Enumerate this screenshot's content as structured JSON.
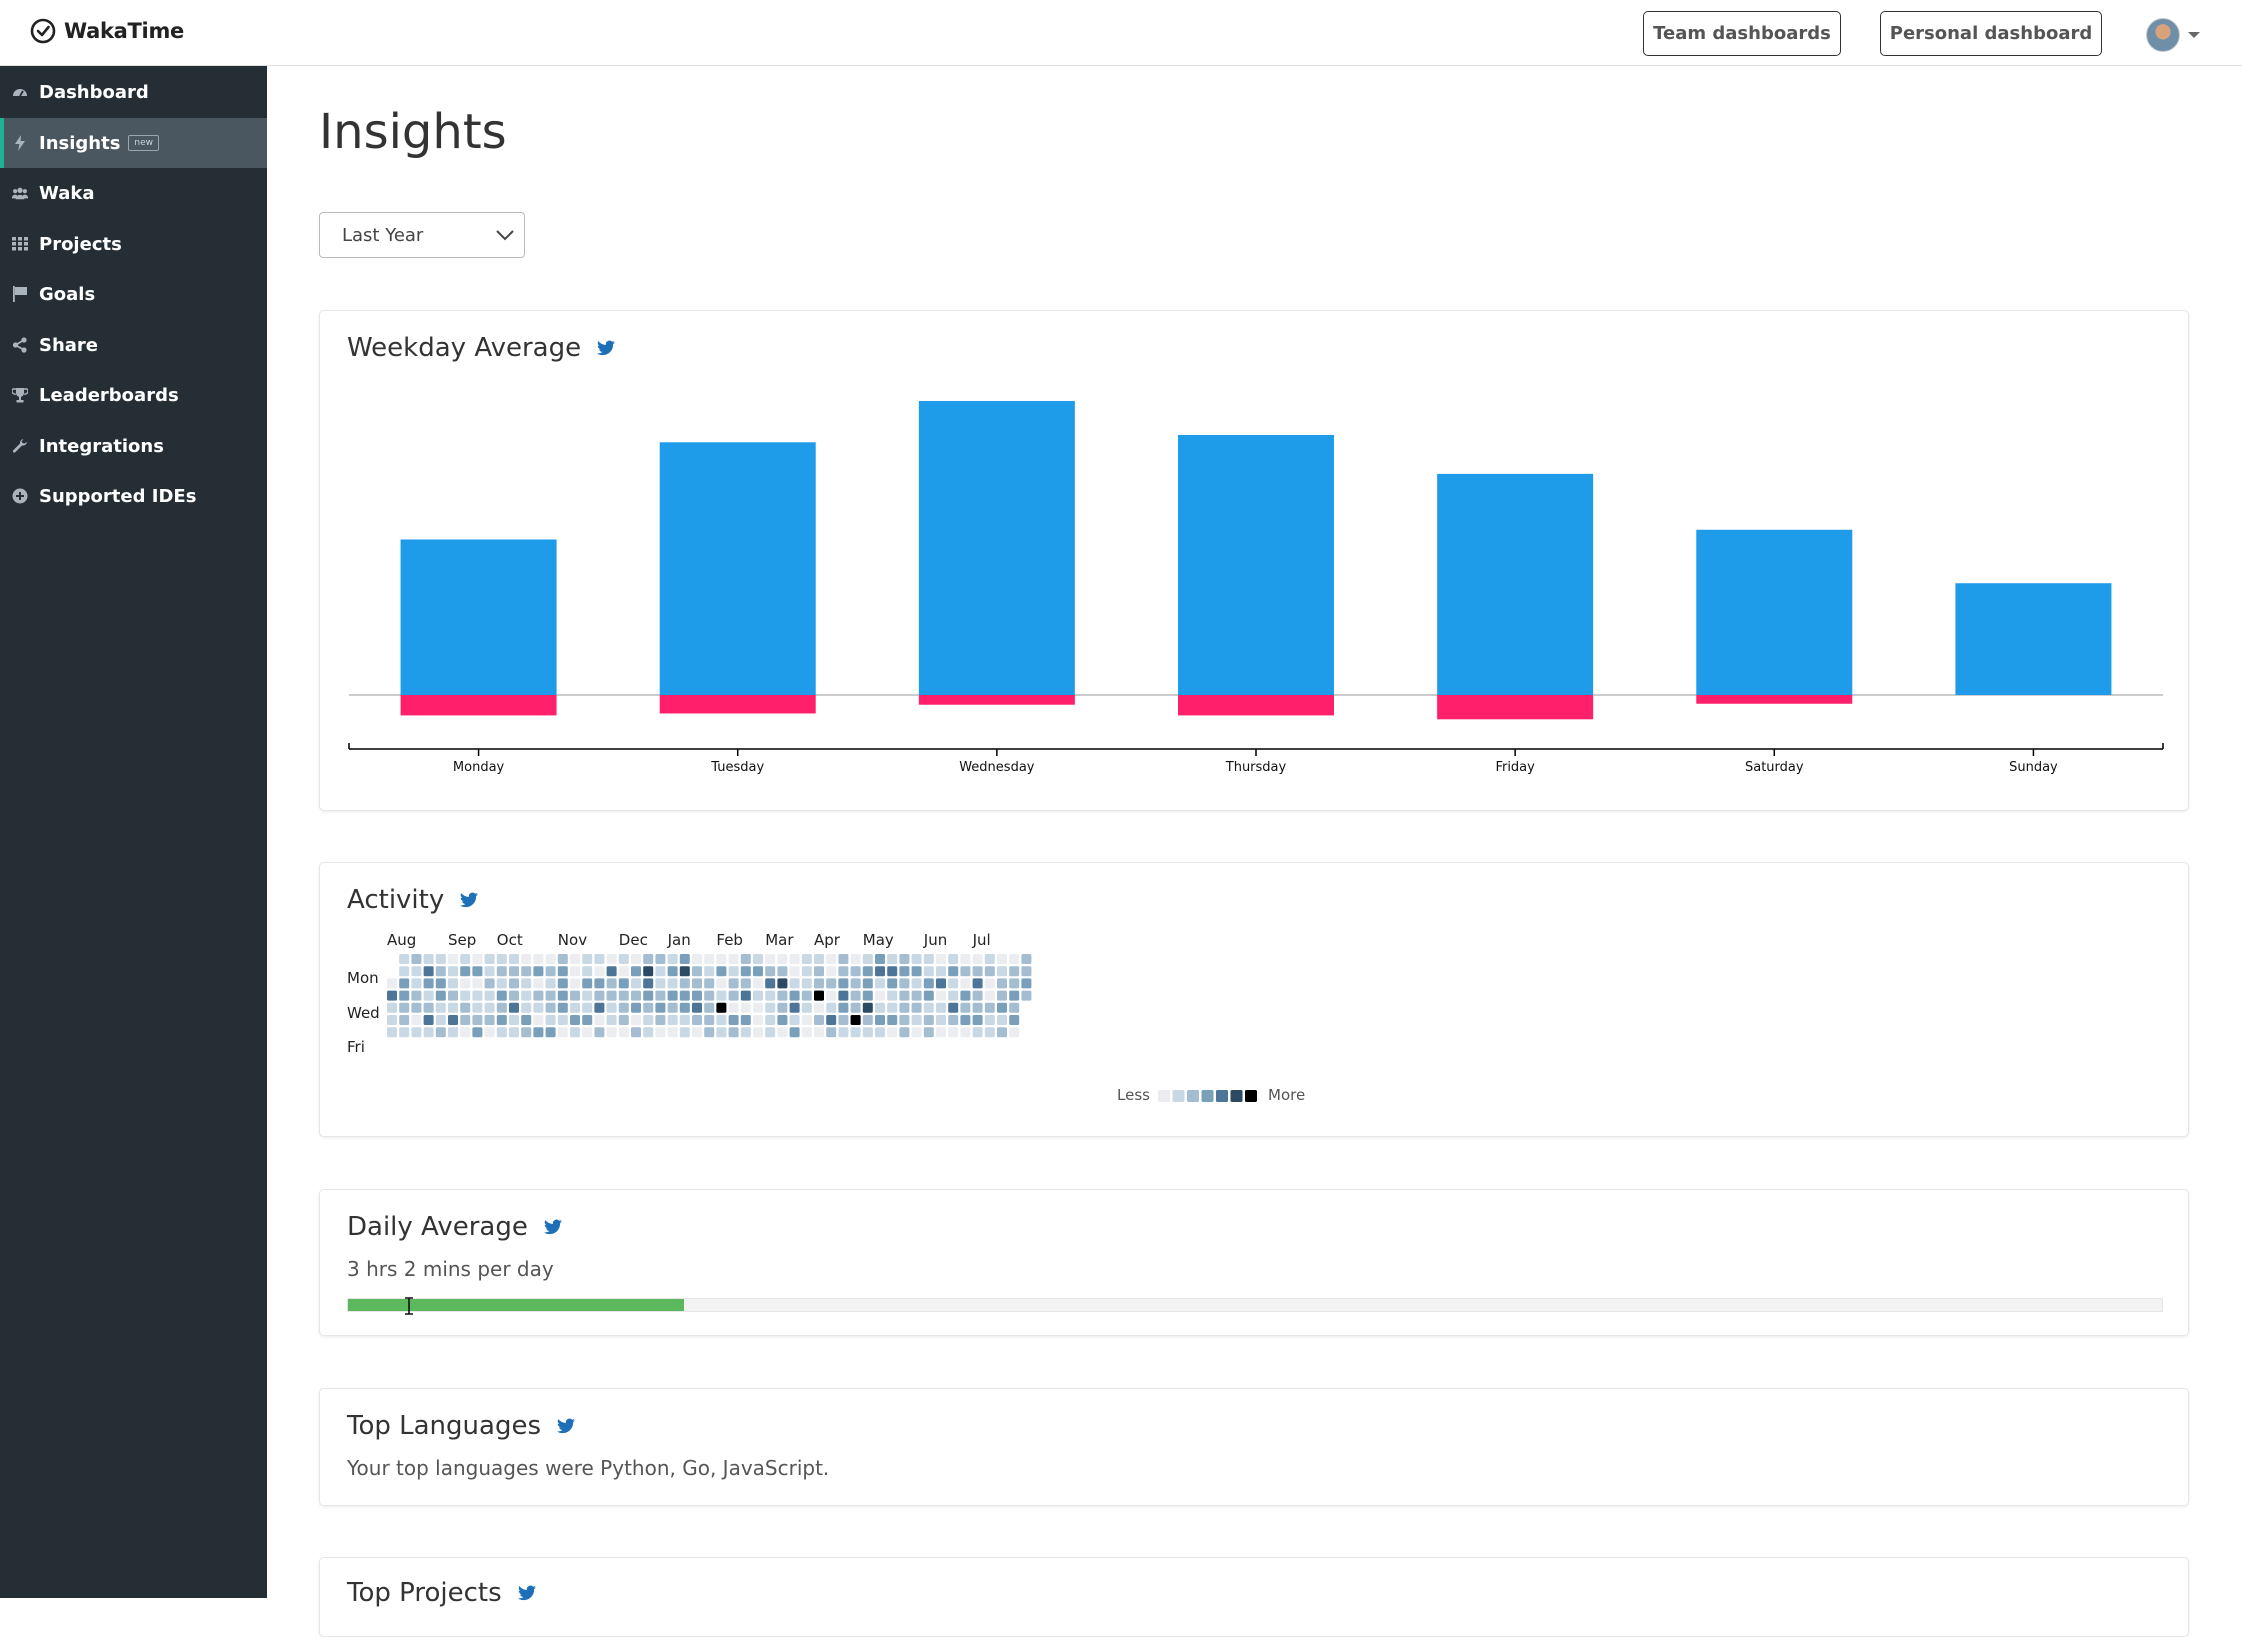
{
  "app": {
    "name": "WakaTime"
  },
  "header": {
    "team_dashboards_label": "Team dashboards",
    "personal_dashboard_label": "Personal dashboard"
  },
  "sidebar": {
    "items": [
      {
        "label": "Dashboard",
        "icon": "dashboard-icon"
      },
      {
        "label": "Insights",
        "icon": "bolt-icon",
        "badge": "new",
        "active": true
      },
      {
        "label": "Waka",
        "icon": "users-icon"
      },
      {
        "label": "Projects",
        "icon": "grid-icon"
      },
      {
        "label": "Goals",
        "icon": "flag-icon"
      },
      {
        "label": "Share",
        "icon": "share-icon"
      },
      {
        "label": "Leaderboards",
        "icon": "trophy-icon"
      },
      {
        "label": "Integrations",
        "icon": "wrench-icon"
      },
      {
        "label": "Supported IDEs",
        "icon": "plus-circle-icon"
      }
    ]
  },
  "main": {
    "title": "Insights",
    "range_select": "Last Year"
  },
  "weekday_card": {
    "title": "Weekday Average"
  },
  "activity_card": {
    "title": "Activity",
    "months": [
      "Aug",
      "Sep",
      "Oct",
      "Nov",
      "Dec",
      "Jan",
      "Feb",
      "Mar",
      "Apr",
      "May",
      "Jun",
      "Jul"
    ],
    "day_labels": [
      "Mon",
      "Wed",
      "Fri"
    ],
    "legend_less": "Less",
    "legend_more": "More",
    "levels": [
      "#ebedf0",
      "#c8d8e4",
      "#a4bdd0",
      "#7a9fba",
      "#4d7597",
      "#2c4a63",
      "#000000"
    ]
  },
  "daily_average_card": {
    "title": "Daily Average",
    "text": "3 hrs 2 mins per day",
    "progress_fraction": 0.185
  },
  "top_languages_card": {
    "title": "Top Languages",
    "text": "Your top languages were Python, Go, JavaScript."
  },
  "top_projects_card": {
    "title": "Top Projects"
  },
  "colors": {
    "bar_positive": "#1e9be9",
    "bar_negative": "#ff1f6b",
    "sidebar_bg": "#262e35",
    "accent": "#1ab394",
    "progress": "#5cb85c",
    "twitter": "#1d6fb8"
  },
  "chart_data": {
    "type": "bar",
    "title": "Weekday Average",
    "categories": [
      "Monday",
      "Tuesday",
      "Wednesday",
      "Thursday",
      "Friday",
      "Saturday",
      "Sunday"
    ],
    "series": [
      {
        "values": [
          3.2,
          5.2,
          6.05,
          5.35,
          4.55,
          3.4,
          2.3
        ]
      },
      {
        "values": [
          -0.42,
          -0.38,
          -0.2,
          -0.42,
          -0.5,
          -0.18,
          0
        ]
      }
    ],
    "ylim": [
      -0.6,
      6.2
    ],
    "grid": false
  }
}
